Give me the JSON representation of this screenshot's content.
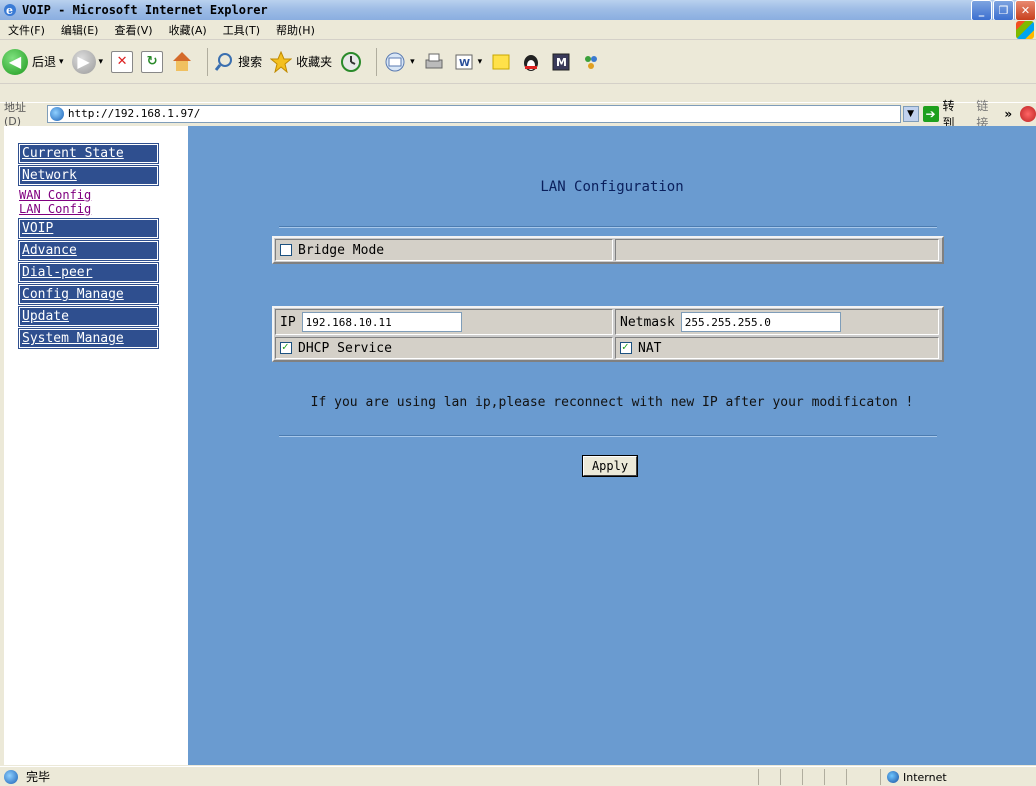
{
  "window": {
    "title": "VOIP - Microsoft Internet Explorer"
  },
  "menu": [
    "文件(F)",
    "编辑(E)",
    "查看(V)",
    "收藏(A)",
    "工具(T)",
    "帮助(H)"
  ],
  "toolbar": {
    "back": "后退",
    "search": "搜索",
    "favorites": "收藏夹"
  },
  "address": {
    "label": "地址(D)",
    "url": "http://192.168.1.97/",
    "go": "转到",
    "links": "链接"
  },
  "sidebar": {
    "current_state": "Current State",
    "network": "Network",
    "wan_config": "WAN Config",
    "lan_config": "LAN Config",
    "voip": "VOIP",
    "advance": "Advance",
    "dial_peer": "Dial-peer",
    "config_manage": "Config Manage",
    "update": "Update",
    "system_manage": "System Manage"
  },
  "main": {
    "title": "LAN Configuration",
    "bridge_mode": {
      "label": "Bridge Mode",
      "checked": false
    },
    "ip": {
      "label": "IP",
      "value": "192.168.10.11"
    },
    "netmask": {
      "label": "Netmask",
      "value": "255.255.255.0"
    },
    "dhcp": {
      "label": "DHCP Service",
      "checked": true
    },
    "nat": {
      "label": "NAT",
      "checked": true
    },
    "note": "If you are using lan ip,please reconnect with new IP after your modificaton !",
    "apply": "Apply"
  },
  "status": {
    "text": "完毕",
    "zone": "Internet"
  },
  "colors": {
    "content_bg": "#6a9bd0",
    "nav_bg": "#2f4f8f",
    "title_color": "#0a1f5c"
  }
}
